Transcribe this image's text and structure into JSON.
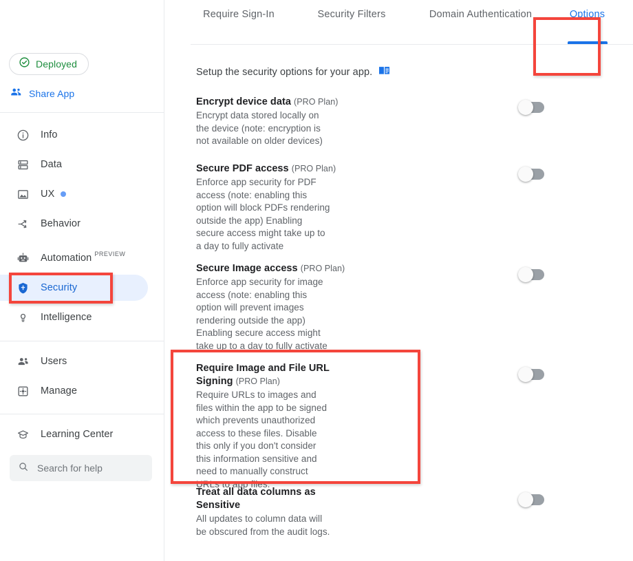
{
  "sidebar": {
    "status_badge": {
      "label": "Deployed",
      "icon": "check-circle-icon",
      "color": "#1e8e3e"
    },
    "share_app": {
      "label": "Share App",
      "icon": "share-people-icon",
      "color": "#1a73e8"
    },
    "nav_primary": [
      {
        "label": "Info",
        "icon": "info-circle-icon",
        "active": false
      },
      {
        "label": "Data",
        "icon": "database-icon",
        "active": false
      },
      {
        "label": "UX",
        "icon": "image-icon",
        "active": false,
        "dot": true
      },
      {
        "label": "Behavior",
        "icon": "behavior-branch-icon",
        "active": false
      },
      {
        "label": "Automation",
        "icon": "robot-icon",
        "active": false,
        "badge": "PREVIEW"
      },
      {
        "label": "Security",
        "icon": "shield-icon",
        "active": true
      },
      {
        "label": "Intelligence",
        "icon": "lightbulb-icon",
        "active": false
      }
    ],
    "nav_secondary": [
      {
        "label": "Users",
        "icon": "users-icon"
      },
      {
        "label": "Manage",
        "icon": "manage-gear-icon"
      }
    ],
    "nav_tertiary": [
      {
        "label": "Learning Center",
        "icon": "graduation-cap-icon"
      }
    ],
    "search": {
      "placeholder": "Search for help",
      "icon": "search-icon"
    }
  },
  "main": {
    "tabs": [
      {
        "label": "Require Sign-In",
        "active": false
      },
      {
        "label": "Security Filters",
        "active": false
      },
      {
        "label": "Domain Authentication",
        "active": false
      },
      {
        "label": "Options",
        "active": true
      }
    ],
    "setup_text": "Setup the security options for your app.",
    "setup_icon": "open-book-icon",
    "settings": [
      {
        "title": "Encrypt device data",
        "plan": "(PRO Plan)",
        "description": "Encrypt data stored locally on the device (note: encryption is not available on older devices)",
        "toggle_on": false
      },
      {
        "title": "Secure PDF access",
        "plan": "(PRO Plan)",
        "description": "Enforce app security for PDF access (note: enabling this option will block PDFs rendering outside the app) Enabling secure access might take up to a day to fully activate",
        "toggle_on": false
      },
      {
        "title": "Secure Image access",
        "plan": "(PRO Plan)",
        "description": "Enforce app security for image access (note: enabling this option will prevent images rendering outside the app) Enabling secure access might take up to a day to fully activate",
        "toggle_on": false
      },
      {
        "title": "Require Image and File URL Signing",
        "plan": "(PRO Plan)",
        "description": "Require URLs to images and files within the app to be signed which prevents unauthorized access to these files. Disable this only if you don't consider this information sensitive and need to manually construct URLs to app files.",
        "toggle_on": false,
        "highlighted": true
      },
      {
        "title": "Treat all data columns as Sensitive",
        "plan": "",
        "description": "All updates to column data will be obscured from the audit logs.",
        "toggle_on": false
      }
    ]
  },
  "annotations": {
    "color": "#f4453c",
    "boxes": [
      {
        "name": "security-nav-highlight"
      },
      {
        "name": "options-tab-highlight"
      },
      {
        "name": "url-signing-setting-highlight"
      }
    ]
  }
}
